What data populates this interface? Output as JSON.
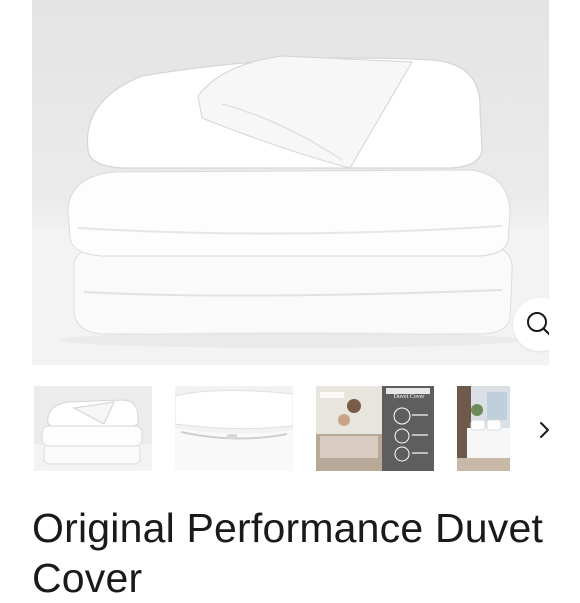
{
  "product": {
    "title": "Original Performance Duvet Cover"
  },
  "gallery": {
    "zoom_icon": "magnifier-icon",
    "next_icon": "chevron-right-icon",
    "thumbnails": [
      {
        "name": "folded-duvet-stack"
      },
      {
        "name": "duvet-zipper-closeup"
      },
      {
        "name": "couple-in-bed-packaging"
      },
      {
        "name": "bedroom-scene"
      }
    ],
    "packaging_label": "Duvet Cover"
  },
  "colors": {
    "text": "#1a1a1a",
    "background": "#ffffff",
    "packaging_panel": "#5e5e5e"
  }
}
